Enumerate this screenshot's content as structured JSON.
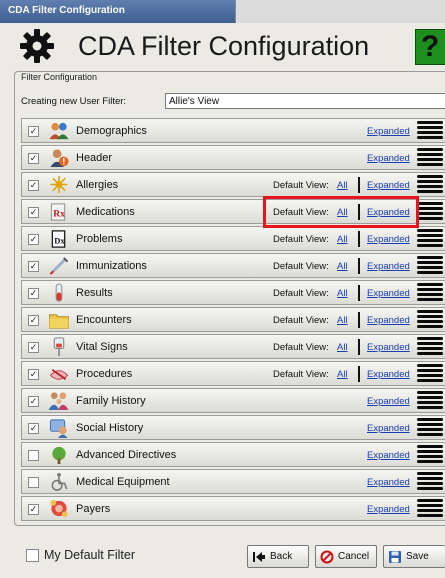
{
  "window": {
    "title": "CDA Filter Configuration"
  },
  "header": {
    "title": "CDA Filter Configuration",
    "help_glyph": "?"
  },
  "filter_config": {
    "legend": "Filter Configuration",
    "new_filter_label": "Creating new User Filter:",
    "new_filter_value": "Allie's View"
  },
  "sections": [
    {
      "label": "Demographics",
      "checked": true,
      "icon": "people-icon",
      "default_view": null,
      "all": null,
      "expanded": "Expanded"
    },
    {
      "label": "Header",
      "checked": true,
      "icon": "person-alert-icon",
      "default_view": null,
      "all": null,
      "expanded": "Expanded"
    },
    {
      "label": "Allergies",
      "checked": true,
      "icon": "pollen-icon",
      "default_view": "Default View:",
      "all": "All",
      "expanded": "Expanded"
    },
    {
      "label": "Medications",
      "checked": true,
      "icon": "rx-icon",
      "default_view": "Default View:",
      "all": "All",
      "expanded": "Expanded"
    },
    {
      "label": "Problems",
      "checked": true,
      "icon": "dx-icon",
      "default_view": "Default View:",
      "all": "All",
      "expanded": "Expanded"
    },
    {
      "label": "Immunizations",
      "checked": true,
      "icon": "syringe-icon",
      "default_view": "Default View:",
      "all": "All",
      "expanded": "Expanded"
    },
    {
      "label": "Results",
      "checked": true,
      "icon": "test-tube-icon",
      "default_view": "Default View:",
      "all": "All",
      "expanded": "Expanded"
    },
    {
      "label": "Encounters",
      "checked": true,
      "icon": "folder-icon",
      "default_view": "Default View:",
      "all": "All",
      "expanded": "Expanded"
    },
    {
      "label": "Vital Signs",
      "checked": true,
      "icon": "iv-bag-icon",
      "default_view": "Default View:",
      "all": "All",
      "expanded": "Expanded"
    },
    {
      "label": "Procedures",
      "checked": true,
      "icon": "procedure-icon",
      "default_view": "Default View:",
      "all": "All",
      "expanded": "Expanded"
    },
    {
      "label": "Family History",
      "checked": true,
      "icon": "family-icon",
      "default_view": null,
      "all": null,
      "expanded": "Expanded"
    },
    {
      "label": "Social History",
      "checked": true,
      "icon": "social-icon",
      "default_view": null,
      "all": null,
      "expanded": "Expanded"
    },
    {
      "label": "Advanced Directives",
      "checked": false,
      "icon": "directive-icon",
      "default_view": null,
      "all": null,
      "expanded": "Expanded"
    },
    {
      "label": "Medical Equipment",
      "checked": false,
      "icon": "wheelchair-icon",
      "default_view": null,
      "all": null,
      "expanded": "Expanded"
    },
    {
      "label": "Payers",
      "checked": true,
      "icon": "payers-icon",
      "default_view": null,
      "all": null,
      "expanded": "Expanded"
    }
  ],
  "footer": {
    "default_filter_label": "My Default Filter",
    "default_filter_checked": false,
    "back_label": "Back",
    "cancel_label": "Cancel",
    "save_label": "Save"
  },
  "colors": {
    "link": "#1a3fb5",
    "highlight": "#e8131b",
    "help_green": "#1e8f1e"
  }
}
